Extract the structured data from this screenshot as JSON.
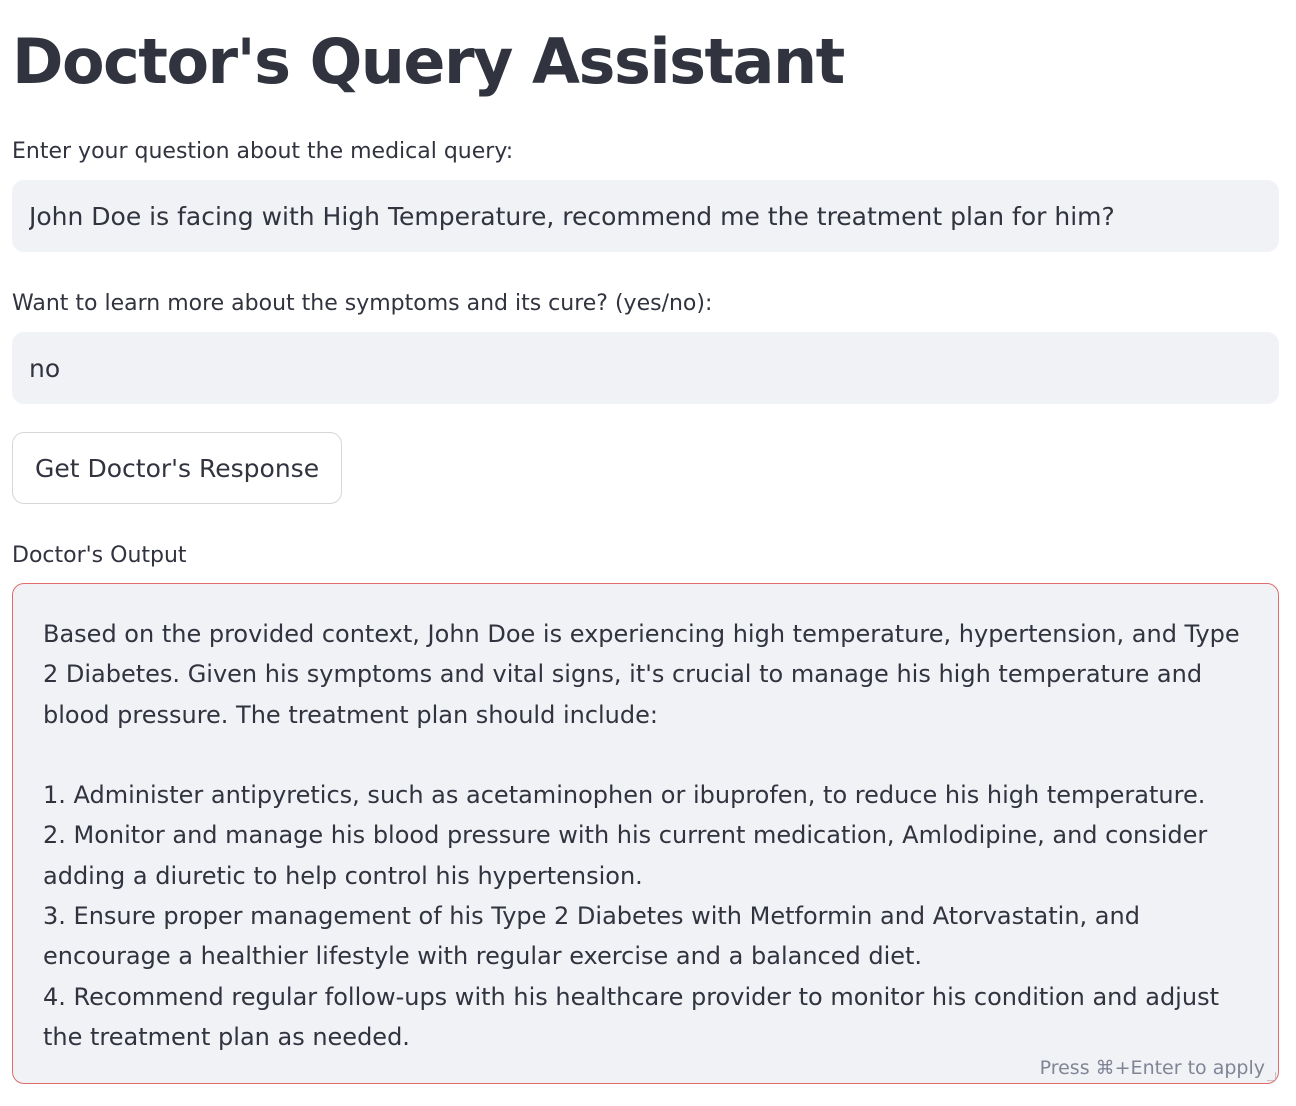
{
  "app": {
    "title": "Doctor's Query Assistant"
  },
  "query_field": {
    "label": "Enter your question about the medical query:",
    "value": "John Doe is facing with High Temperature, recommend me the treatment plan for him?"
  },
  "learn_more_field": {
    "label": "Want to learn more about the symptoms and its cure? (yes/no):",
    "value": "no"
  },
  "submit_button": {
    "label": "Get Doctor's Response"
  },
  "output": {
    "label": "Doctor's Output",
    "text": "Based on the provided context, John Doe is experiencing high temperature, hypertension, and Type 2 Diabetes. Given his symptoms and vital signs, it's crucial to manage his high temperature and blood pressure. The treatment plan should include:\n\n1. Administer antipyretics, such as acetaminophen or ibuprofen, to reduce his high temperature.\n2. Monitor and manage his blood pressure with his current medication, Amlodipine, and consider adding a diuretic to help control his hypertension.\n3. Ensure proper management of his Type 2 Diabetes with Metformin and Atorvastatin, and encourage a healthier lifestyle with regular exercise and a balanced diet.\n4. Recommend regular follow-ups with his healthcare provider to monitor his condition and adjust the treatment plan as needed.",
    "hint": "Press ⌘+Enter to apply"
  },
  "colors": {
    "text": "#31333f",
    "input_background": "#f0f2f6",
    "output_border": "#e06c6c",
    "hint_text": "#808495"
  }
}
